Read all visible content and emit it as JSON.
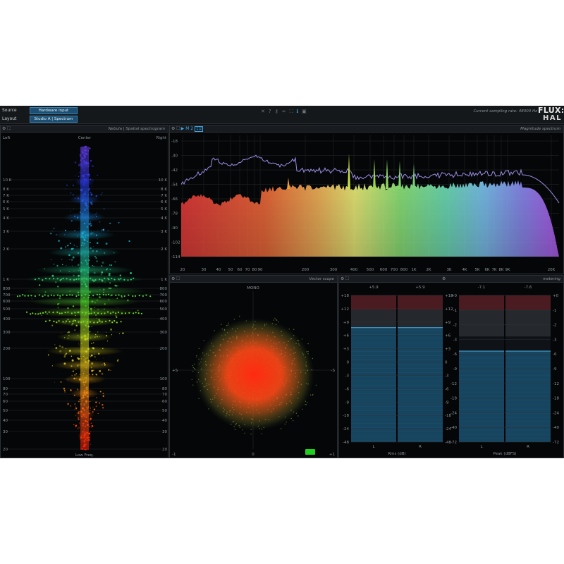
{
  "topbar": {
    "source_label": "Source",
    "source_value": "Hardware input",
    "layout_label": "Layout",
    "layout_value": "Studio A | Spectrum",
    "sampling_rate_text": "Current sampling rate: 48000 Hz",
    "logo_top": "FLUX:",
    "logo_bottom": "HAL",
    "center_icons": [
      "close-icon",
      "help-icon",
      "key-icon",
      "link-icon",
      "fullscreen-icon",
      "info-icon",
      "settings-icon"
    ]
  },
  "nebula": {
    "title": "Nebula | Spatial spectrogram",
    "left_label": "Left",
    "center_label": "Center",
    "right_label": "Right",
    "bottom_label": "Low Freq.",
    "freq_labels": [
      "10 K",
      "8 K",
      "7 K",
      "6 K",
      "5 K",
      "4 K",
      "3 K",
      "2 K",
      "1 K",
      "800",
      "700",
      "600",
      "500",
      "400",
      "300",
      "200",
      "100",
      "80",
      "70",
      "60",
      "50",
      "40",
      "30",
      "20"
    ]
  },
  "spectrum": {
    "title": "Magnitude spectrum",
    "play_icon": "play-icon",
    "channel_label": "M",
    "channel_num": "2",
    "mode_label": "1|2",
    "db_labels": [
      "-18",
      "-30",
      "-42",
      "-54",
      "-66",
      "-78",
      "-90",
      "-102",
      "-114"
    ],
    "freq_labels": [
      "20",
      "30",
      "40",
      "50",
      "60",
      "70",
      "80",
      "90",
      "200",
      "300",
      "400",
      "500",
      "600",
      "700",
      "800",
      "1K",
      "2K",
      "3K",
      "4K",
      "5K",
      "6K",
      "7K",
      "8K",
      "9K",
      "20K"
    ]
  },
  "vector": {
    "title": "Vector scope",
    "top_label": "MONO",
    "left_label": "+S",
    "right_label": "-S",
    "bottom_left": "-1",
    "bottom_center": "0",
    "bottom_right": "+1"
  },
  "metering": {
    "title": "metering",
    "rms": {
      "peak_left": "+5.9",
      "peak_right": "+5.9",
      "level_left": 0.78,
      "level_right": 0.78,
      "scale": [
        "+18",
        "+12",
        "+9",
        "+6",
        "+3",
        "0",
        "-3",
        "-6",
        "-9",
        "-18",
        "-24",
        "-48"
      ],
      "label_l": "L",
      "label_r": "R",
      "unit": "Rms (dB)"
    },
    "peak": {
      "peak_left": "-7.1",
      "peak_right": "-7.6",
      "level_left": 0.62,
      "level_right": 0.62,
      "scale": [
        "+0",
        "-1",
        "-2",
        "-3",
        "-6",
        "-9",
        "-12",
        "-18",
        "-24",
        "-40",
        "-72"
      ],
      "label_l": "L",
      "label_r": "R",
      "unit": "Peak (dBFS)"
    }
  }
}
